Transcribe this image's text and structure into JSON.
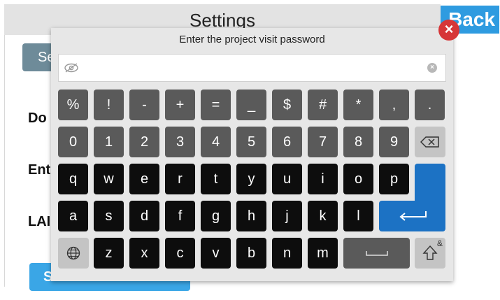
{
  "header": {
    "title": "Settings",
    "back_label": "Back"
  },
  "background": {
    "tab_label": "Se",
    "labels": [
      "Do",
      "Ent",
      "LAI"
    ],
    "calibration_label": "Screen Calibration"
  },
  "dialog": {
    "title": "Enter the project visit password",
    "password_value": "",
    "close_symbol": "×"
  },
  "keyboard": {
    "symbols_row": [
      "%",
      "!",
      "-",
      "+",
      "=",
      "_",
      "$",
      "#",
      "*",
      ",",
      "."
    ],
    "digits_row": [
      "0",
      "1",
      "2",
      "3",
      "4",
      "5",
      "6",
      "7",
      "8",
      "9"
    ],
    "row_q": [
      "q",
      "w",
      "e",
      "r",
      "t",
      "y",
      "u",
      "i",
      "o",
      "p"
    ],
    "row_a": [
      "a",
      "s",
      "d",
      "f",
      "g",
      "h",
      "j",
      "k",
      "l"
    ],
    "row_z": [
      "z",
      "x",
      "c",
      "v",
      "b",
      "n",
      "m"
    ],
    "shift_superscript": "&",
    "icons": [
      "eye-icon",
      "clear-icon",
      "backspace-icon",
      "enter-icon",
      "globe-icon",
      "space-icon",
      "shift-icon"
    ],
    "colors": {
      "symbol_key": "#5a5a5a",
      "letter_key": "#0d0d0d",
      "enter_key": "#1c72c4",
      "function_key": "#c4c4c4"
    }
  }
}
